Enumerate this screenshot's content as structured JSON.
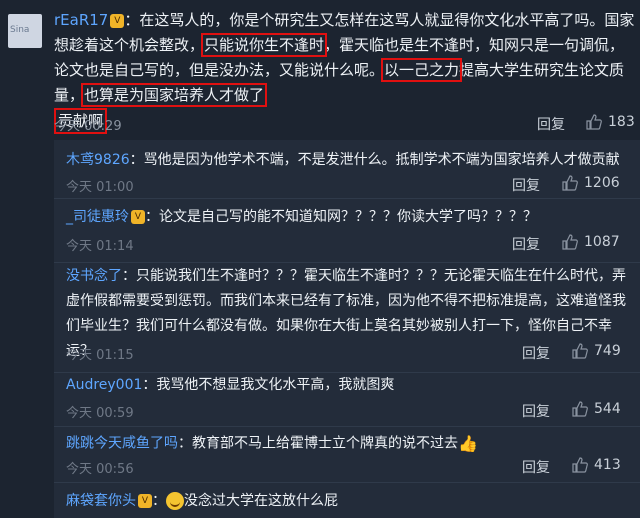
{
  "main_comment": {
    "avatar_text": "Sina",
    "username": "rEaR17",
    "vip_badge": "V",
    "text_part1": "：在这骂人的，你是个研究生又怎样在这骂人就显得你文化水平高了吗。国家想趁着这个机会整改，",
    "highlight1": "只能说你生不逢时",
    "text_part2": "，霍天临也是生不逢时，知网只是一句调侃，论文也是自己写的，但是没办法，又能说什么呢。",
    "highlight2": "以一己之力",
    "text_part3": "提高大学生研究生论文质量，",
    "highlight3": "也算是为国家培养人才做了",
    "highlight4": "贡献啊",
    "time": "今天 00:29",
    "reply_label": "回复",
    "likes": "183"
  },
  "replies": [
    {
      "username": "木鸢9826",
      "text": "：骂他是因为他学术不端，不是发泄什么。抵制学术不端为国家培养人才做贡献",
      "time": "今天 01:00",
      "reply_label": "回复",
      "likes": "1206"
    },
    {
      "username": "_司徒惠玲",
      "vip_badge": "V",
      "text": "：论文是自己写的能不知道知网？？？？你读大学了吗？？？？",
      "time": "今天 01:14",
      "reply_label": "回复",
      "likes": "1087"
    },
    {
      "username": "没书念了",
      "text": "：只能说我们生不逢时？？？霍天临生不逢时？？？无论霍天临生在什么时代，弄虚作假都需要受到惩罚。而我们本来已经有了标准，因为他不得不把标准提高，这难道怪我们毕业生？我们可什么都没有做。如果你在大街上莫名其妙被别人打一下，怪你自己不幸运？",
      "time": "今天 01:15",
      "reply_label": "回复",
      "likes": "749"
    },
    {
      "username": "Audrey001",
      "text": "：我骂他不想显我文化水平高，我就图爽",
      "time": "今天 00:59",
      "reply_label": "回复",
      "likes": "544"
    },
    {
      "username": "跳跳今天咸鱼了吗",
      "text": "：教育部不马上给霍博士立个牌真的说不过去",
      "time": "今天 00:56",
      "reply_label": "回复",
      "likes": "413"
    },
    {
      "username": "麻袋套你头",
      "vip_badge": "V",
      "text": "：没念过大学在这放什么屁"
    }
  ],
  "icons": {
    "thumb": "thumbs-up-icon"
  },
  "colors": {
    "username": "#5ea6ff",
    "highlight_box": "#e01010",
    "background": "#1c2430"
  }
}
